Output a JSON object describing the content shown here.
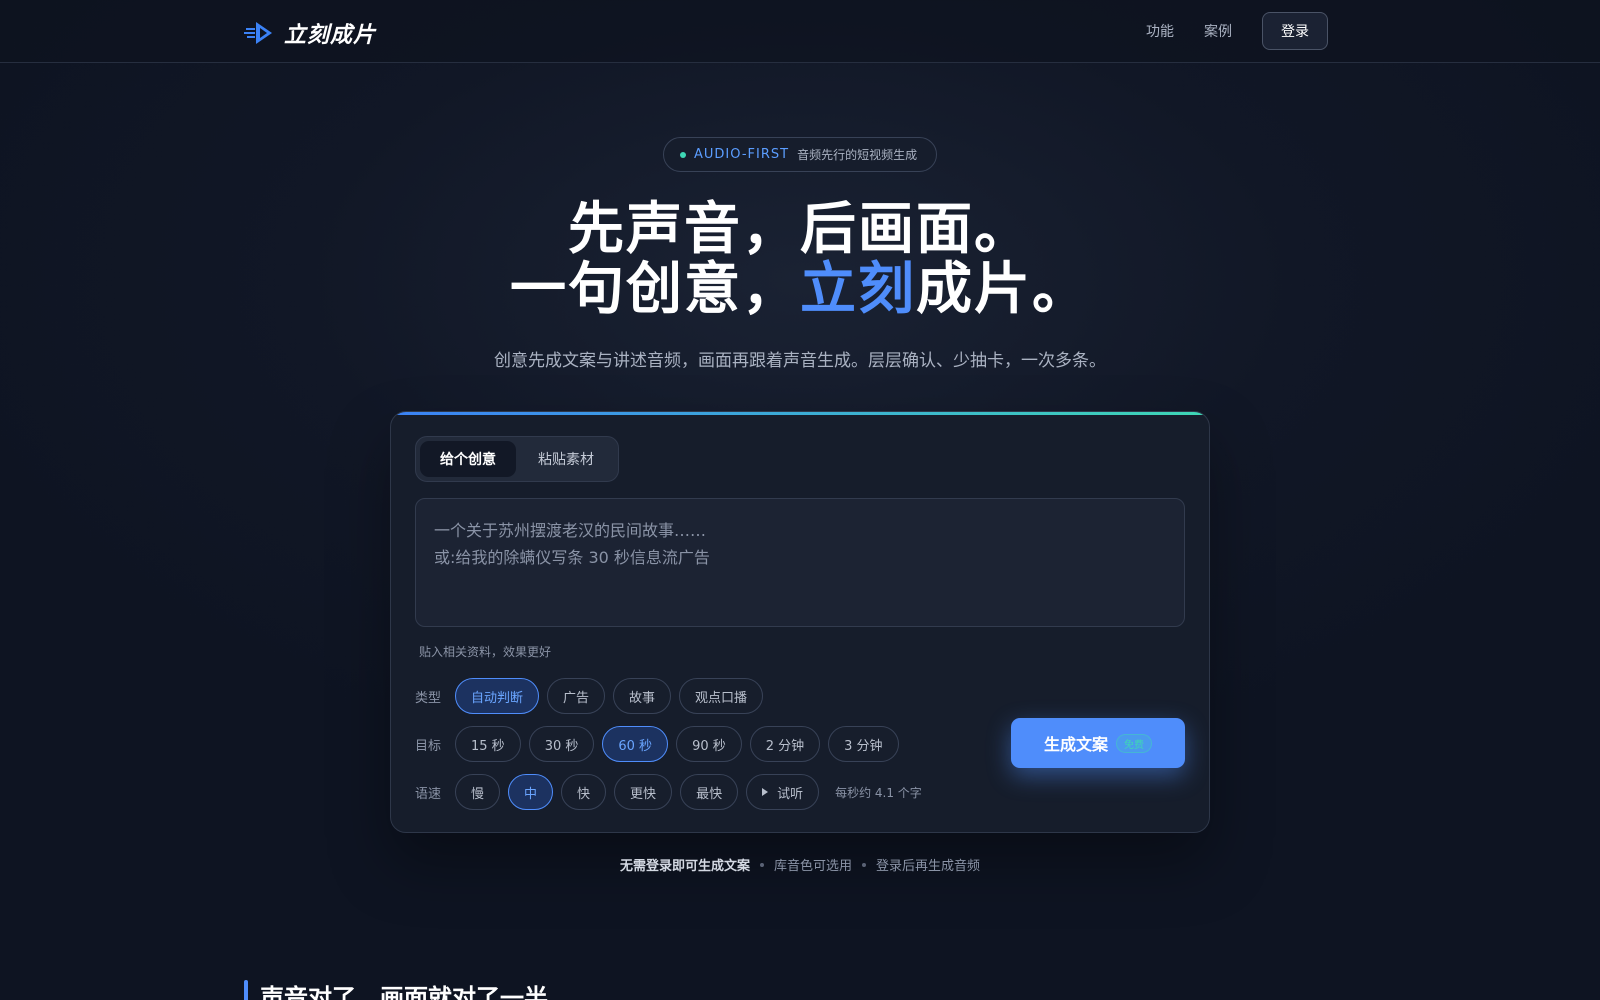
{
  "nav": {
    "brand_name": "立刻成片",
    "links": [
      "功能",
      "案例"
    ],
    "login_label": "登录"
  },
  "hero": {
    "pill_tag": "AUDIO-FIRST",
    "pill_text": "音频先行的短视频生成",
    "title_line1": "先声音，后画面。",
    "title_line2_pre": "一句创意，",
    "title_line2_accent": "立刻",
    "title_line2_post": "成片。",
    "subtitle": "创意先成文案与讲述音频，画面再跟着声音生成。层层确认、少抽卡，一次多条。"
  },
  "card": {
    "tabs": [
      {
        "label": "给个创意",
        "active": true
      },
      {
        "label": "粘贴素材",
        "active": false
      }
    ],
    "textarea_lines": [
      "一个关于苏州摆渡老汉的民间故事……",
      "或:给我的除螨仪写条 30 秒信息流广告"
    ],
    "hint": "贴入相关资料，效果更好",
    "type_label": "类型",
    "types": [
      "自动判断",
      "广告",
      "故事",
      "观点口播"
    ],
    "type_selected": "自动判断",
    "target_label": "目标",
    "targets": [
      "15 秒",
      "30 秒",
      "60 秒",
      "90 秒",
      "2 分钟",
      "3 分钟"
    ],
    "target_selected": "60 秒",
    "speed_label": "语速",
    "speeds": [
      "慢",
      "中",
      "快",
      "更快",
      "最快"
    ],
    "speed_selected": "中",
    "listen_label": "试听",
    "rate_text": "每秒约 4.1 个字",
    "generate_label": "生成文案",
    "free_badge": "免费"
  },
  "footnote": {
    "strong": "无需登录即可生成文案",
    "item2": "库音色可选用",
    "item3": "登录后再生成音频"
  },
  "section": {
    "title": "声音对了，画面就对了一半"
  },
  "colors": {
    "accent": "#4f8dfb",
    "teal": "#3ed7b5",
    "background": "#111726"
  }
}
